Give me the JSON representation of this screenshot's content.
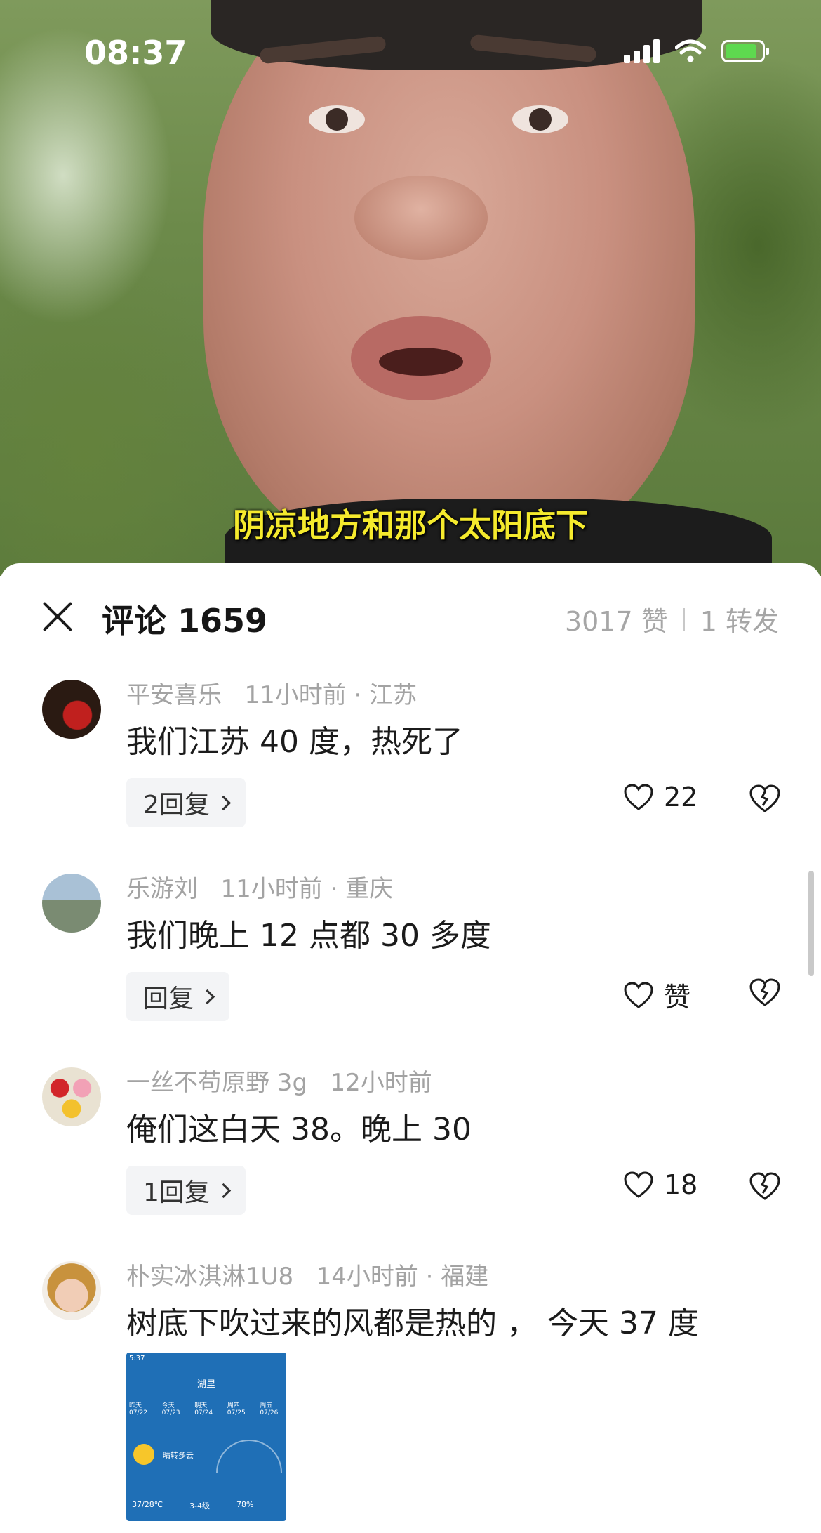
{
  "status_bar": {
    "time": "08:37"
  },
  "video": {
    "subtitle": "阴凉地方和那个太阳底下"
  },
  "panel": {
    "title": "评论 1659",
    "likes": "3017 赞",
    "shares": "1 转发"
  },
  "comments": [
    {
      "user": "平安喜乐",
      "time": "11小时前 · 江苏",
      "text": "我们江苏 40 度，热死了",
      "reply": "2回复",
      "likes": "22"
    },
    {
      "user": "乐游刘",
      "time": "11小时前 · 重庆",
      "text": "我们晚上 12 点都 30 多度",
      "reply": "回复",
      "likes": "赞"
    },
    {
      "user": "一丝不苟原野 3g",
      "time": "12小时前",
      "text": "俺们这白天 38。晚上 30",
      "reply": "1回复",
      "likes": "18"
    },
    {
      "user": "朴实冰淇淋1U8",
      "time": "14小时前 · 福建",
      "text": "树底下吹过来的风都是热的 ， 今天 37 度"
    }
  ],
  "attachment": {
    "status": "5:37",
    "title": "湖里",
    "days": [
      "昨天 07/22",
      "今天 07/23",
      "明天 07/24",
      "周四 07/25",
      "周五 07/26"
    ],
    "weather": "晴转多云",
    "temp": "37/28℃",
    "wind": "3-4级",
    "humidity": "78%"
  },
  "colors": {
    "subtitle": "#f5ea2d",
    "meta": "#a3a3a3",
    "battery": "#5ed94f"
  }
}
